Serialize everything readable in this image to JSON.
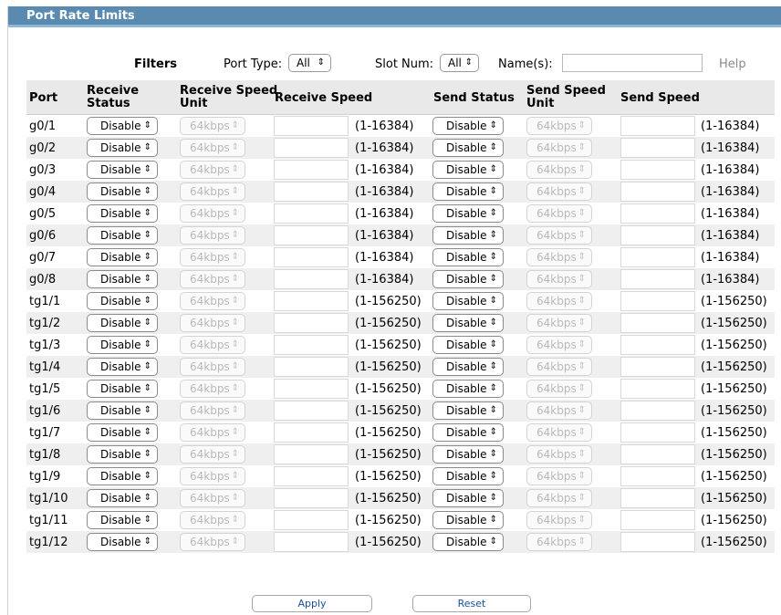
{
  "panel": {
    "title": "Port Rate Limits"
  },
  "filters": {
    "label": "Filters",
    "port_type_label": "Port Type:",
    "port_type_value": "All",
    "slot_num_label": "Slot Num:",
    "slot_num_value": "All",
    "names_label": "Name(s):",
    "names_value": "",
    "help_label": "Help"
  },
  "table": {
    "headers": {
      "port": "Port",
      "receive_status_1": "Receive",
      "receive_status_2": "Status",
      "receive_unit_1": "Receive Speed",
      "receive_unit_2": "Unit",
      "receive_speed": "Receive Speed",
      "send_status": "Send Status",
      "send_unit_1": "Send Speed",
      "send_unit_2": "Unit",
      "send_speed": "Send Speed"
    },
    "rows": [
      {
        "port": "g0/1",
        "receive_status": "Disable",
        "receive_unit": "64kbps",
        "receive_speed": "",
        "receive_range": "(1-16384)",
        "send_status": "Disable",
        "send_unit": "64kbps",
        "send_speed": "",
        "send_range": "(1-16384)"
      },
      {
        "port": "g0/2",
        "receive_status": "Disable",
        "receive_unit": "64kbps",
        "receive_speed": "",
        "receive_range": "(1-16384)",
        "send_status": "Disable",
        "send_unit": "64kbps",
        "send_speed": "",
        "send_range": "(1-16384)"
      },
      {
        "port": "g0/3",
        "receive_status": "Disable",
        "receive_unit": "64kbps",
        "receive_speed": "",
        "receive_range": "(1-16384)",
        "send_status": "Disable",
        "send_unit": "64kbps",
        "send_speed": "",
        "send_range": "(1-16384)"
      },
      {
        "port": "g0/4",
        "receive_status": "Disable",
        "receive_unit": "64kbps",
        "receive_speed": "",
        "receive_range": "(1-16384)",
        "send_status": "Disable",
        "send_unit": "64kbps",
        "send_speed": "",
        "send_range": "(1-16384)"
      },
      {
        "port": "g0/5",
        "receive_status": "Disable",
        "receive_unit": "64kbps",
        "receive_speed": "",
        "receive_range": "(1-16384)",
        "send_status": "Disable",
        "send_unit": "64kbps",
        "send_speed": "",
        "send_range": "(1-16384)"
      },
      {
        "port": "g0/6",
        "receive_status": "Disable",
        "receive_unit": "64kbps",
        "receive_speed": "",
        "receive_range": "(1-16384)",
        "send_status": "Disable",
        "send_unit": "64kbps",
        "send_speed": "",
        "send_range": "(1-16384)"
      },
      {
        "port": "g0/7",
        "receive_status": "Disable",
        "receive_unit": "64kbps",
        "receive_speed": "",
        "receive_range": "(1-16384)",
        "send_status": "Disable",
        "send_unit": "64kbps",
        "send_speed": "",
        "send_range": "(1-16384)"
      },
      {
        "port": "g0/8",
        "receive_status": "Disable",
        "receive_unit": "64kbps",
        "receive_speed": "",
        "receive_range": "(1-16384)",
        "send_status": "Disable",
        "send_unit": "64kbps",
        "send_speed": "",
        "send_range": "(1-16384)"
      },
      {
        "port": "tg1/1",
        "receive_status": "Disable",
        "receive_unit": "64kbps",
        "receive_speed": "",
        "receive_range": "(1-156250)",
        "send_status": "Disable",
        "send_unit": "64kbps",
        "send_speed": "",
        "send_range": "(1-156250)"
      },
      {
        "port": "tg1/2",
        "receive_status": "Disable",
        "receive_unit": "64kbps",
        "receive_speed": "",
        "receive_range": "(1-156250)",
        "send_status": "Disable",
        "send_unit": "64kbps",
        "send_speed": "",
        "send_range": "(1-156250)"
      },
      {
        "port": "tg1/3",
        "receive_status": "Disable",
        "receive_unit": "64kbps",
        "receive_speed": "",
        "receive_range": "(1-156250)",
        "send_status": "Disable",
        "send_unit": "64kbps",
        "send_speed": "",
        "send_range": "(1-156250)"
      },
      {
        "port": "tg1/4",
        "receive_status": "Disable",
        "receive_unit": "64kbps",
        "receive_speed": "",
        "receive_range": "(1-156250)",
        "send_status": "Disable",
        "send_unit": "64kbps",
        "send_speed": "",
        "send_range": "(1-156250)"
      },
      {
        "port": "tg1/5",
        "receive_status": "Disable",
        "receive_unit": "64kbps",
        "receive_speed": "",
        "receive_range": "(1-156250)",
        "send_status": "Disable",
        "send_unit": "64kbps",
        "send_speed": "",
        "send_range": "(1-156250)"
      },
      {
        "port": "tg1/6",
        "receive_status": "Disable",
        "receive_unit": "64kbps",
        "receive_speed": "",
        "receive_range": "(1-156250)",
        "send_status": "Disable",
        "send_unit": "64kbps",
        "send_speed": "",
        "send_range": "(1-156250)"
      },
      {
        "port": "tg1/7",
        "receive_status": "Disable",
        "receive_unit": "64kbps",
        "receive_speed": "",
        "receive_range": "(1-156250)",
        "send_status": "Disable",
        "send_unit": "64kbps",
        "send_speed": "",
        "send_range": "(1-156250)"
      },
      {
        "port": "tg1/8",
        "receive_status": "Disable",
        "receive_unit": "64kbps",
        "receive_speed": "",
        "receive_range": "(1-156250)",
        "send_status": "Disable",
        "send_unit": "64kbps",
        "send_speed": "",
        "send_range": "(1-156250)"
      },
      {
        "port": "tg1/9",
        "receive_status": "Disable",
        "receive_unit": "64kbps",
        "receive_speed": "",
        "receive_range": "(1-156250)",
        "send_status": "Disable",
        "send_unit": "64kbps",
        "send_speed": "",
        "send_range": "(1-156250)"
      },
      {
        "port": "tg1/10",
        "receive_status": "Disable",
        "receive_unit": "64kbps",
        "receive_speed": "",
        "receive_range": "(1-156250)",
        "send_status": "Disable",
        "send_unit": "64kbps",
        "send_speed": "",
        "send_range": "(1-156250)"
      },
      {
        "port": "tg1/11",
        "receive_status": "Disable",
        "receive_unit": "64kbps",
        "receive_speed": "",
        "receive_range": "(1-156250)",
        "send_status": "Disable",
        "send_unit": "64kbps",
        "send_speed": "",
        "send_range": "(1-156250)"
      },
      {
        "port": "tg1/12",
        "receive_status": "Disable",
        "receive_unit": "64kbps",
        "receive_speed": "",
        "receive_range": "(1-156250)",
        "send_status": "Disable",
        "send_unit": "64kbps",
        "send_speed": "",
        "send_range": "(1-156250)"
      }
    ]
  },
  "actions": {
    "apply_label": "Apply",
    "reset_label": "Reset"
  },
  "icons": {
    "select_arrow": "updown-arrow-icon"
  },
  "colors": {
    "header_bar": "#5a8ab0",
    "header_accent": "#8db7d6",
    "table_header_bg": "#e9e9e9",
    "link_blue": "#1a4f9c"
  }
}
